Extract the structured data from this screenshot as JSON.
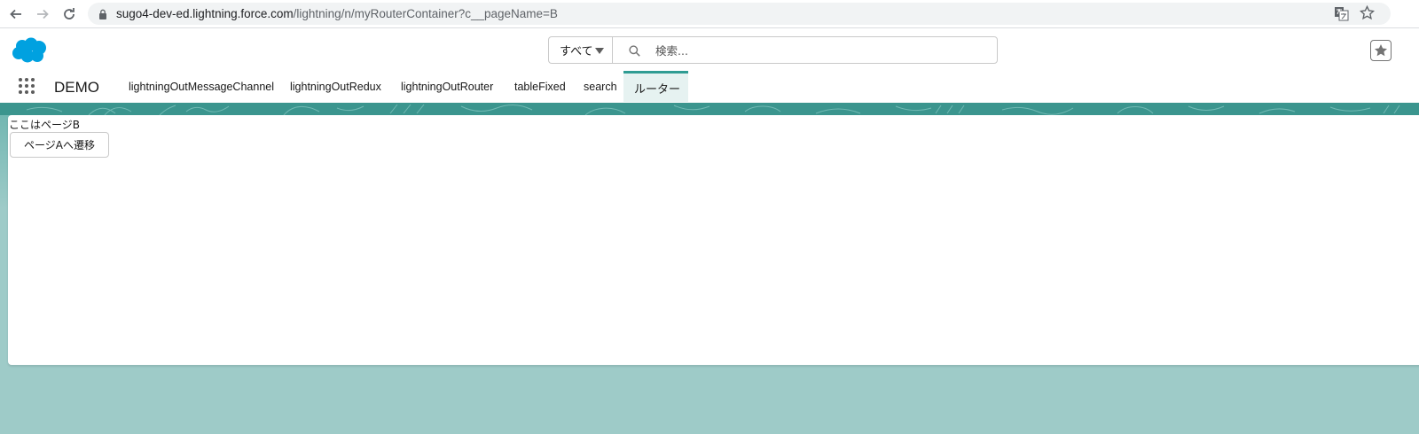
{
  "browser": {
    "url_host": "sugo4-dev-ed.lightning.force.com",
    "url_path": "/lightning/n/myRouterContainer?c__pageName=B"
  },
  "header": {
    "search_scope": "すべて",
    "search_placeholder": "検索..."
  },
  "app_nav": {
    "app_name": "DEMO",
    "tabs": [
      {
        "label": "lightningOutMessageChannel"
      },
      {
        "label": "lightningOutRedux"
      },
      {
        "label": "lightningOutRouter"
      },
      {
        "label": "tableFixed"
      },
      {
        "label": "search"
      },
      {
        "label": "ルーター"
      }
    ]
  },
  "content": {
    "page_label": "ここはページB",
    "nav_button_label": "ページAへ遷移"
  },
  "colors": {
    "salesforce_blue": "#00a1e0",
    "active_tab_accent": "#2f9c93",
    "background_teal": "#9ecbc8"
  }
}
